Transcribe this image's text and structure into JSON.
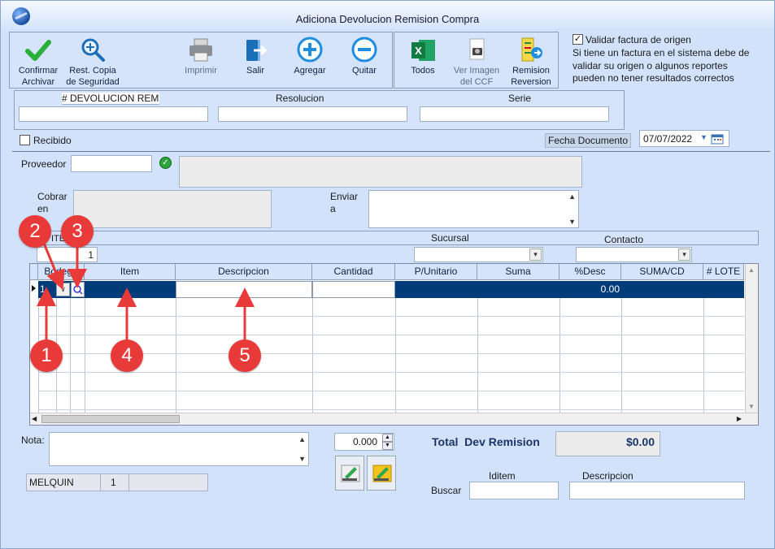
{
  "window": {
    "title": "Adiciona Devolucion Remision Compra"
  },
  "toolbar": {
    "confirm_line1": "Confirmar",
    "confirm_line2": "Archivar",
    "backup_line1": "Rest. Copia",
    "backup_line2": "de Seguridad",
    "print": "Imprimir",
    "exit": "Salir",
    "add": "Agregar",
    "remove": "Quitar",
    "all": "Todos",
    "view_line1": "Ver Imagen",
    "view_line2": "del CCF",
    "reversal_line1": "Remision",
    "reversal_line2": "Reversion"
  },
  "validation": {
    "checkbox_label": "Validar factura de origen",
    "checked": true,
    "note_line1": "Si tiene un factura en el sistema debe de",
    "note_line2": "validar su origen o algunos reportes",
    "note_line3": "pueden no tener resultados correctos"
  },
  "header_fields": {
    "devolucion_label": "# DEVOLUCION REM",
    "resolucion_label": "Resolucion",
    "serie_label": "Serie"
  },
  "received": {
    "label": "Recibido",
    "checked": false
  },
  "document_date": {
    "label": "Fecha Documento",
    "value": "07/07/2022"
  },
  "supplier": {
    "proveedor_label": "Proveedor",
    "cobrar_line1": "Cobrar",
    "cobrar_line2": "en",
    "enviar_line1": "Enviar",
    "enviar_line2": "a"
  },
  "branch_bar": {
    "item_label": "ITE",
    "item_count": "1",
    "sucursal_label": "Sucursal",
    "contacto_label": "Contacto"
  },
  "grid": {
    "columns": [
      "Bodega",
      "Item",
      "Descripcion",
      "Cantidad",
      "P/Unitario",
      "Suma",
      "%Desc",
      "SUMA/CD",
      "# LOTE"
    ],
    "row1": {
      "bodega": "1",
      "desc_pct": "0.00"
    }
  },
  "callouts": [
    "1",
    "2",
    "3",
    "4",
    "5"
  ],
  "footer": {
    "nota_label": "Nota:",
    "quantity_value": "0.000",
    "total_label": "Total  Dev Remision",
    "total_value": "$0.00",
    "user_name": "MELQUIN",
    "user_code": "1",
    "iditem_label": "Iditem",
    "descripcion_label": "Descripcion",
    "buscar_label": "Buscar"
  },
  "colors": {
    "accent": "#003b7a",
    "callout": "#e93a3a",
    "background": "#d2e2fb"
  }
}
